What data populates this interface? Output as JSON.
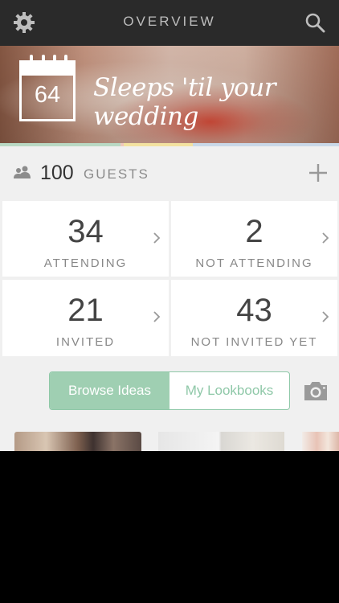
{
  "header": {
    "title": "OVERVIEW",
    "settings_icon": "gear-icon",
    "search_icon": "search-icon"
  },
  "countdown": {
    "days": "64",
    "text": "Sleeps 'til your wedding",
    "strip_colors": [
      "#b9d9c4",
      "#efc7bd",
      "#f3e2a0",
      "#c9d8e8"
    ]
  },
  "guests": {
    "count": "100",
    "label": "GUESTS",
    "add_icon": "plus-icon"
  },
  "stats": [
    {
      "value": "34",
      "label": "ATTENDING"
    },
    {
      "value": "2",
      "label": "NOT ATTENDING"
    },
    {
      "value": "21",
      "label": "INVITED"
    },
    {
      "value": "43",
      "label": "NOT INVITED YET"
    }
  ],
  "ideas": {
    "tabs": [
      "Browse Ideas",
      "My Lookbooks"
    ],
    "selected": "Browse Ideas",
    "camera_icon": "camera-icon"
  },
  "colors": {
    "topbar": "#2a2a2a",
    "accent_green": "#9fcfb2"
  }
}
